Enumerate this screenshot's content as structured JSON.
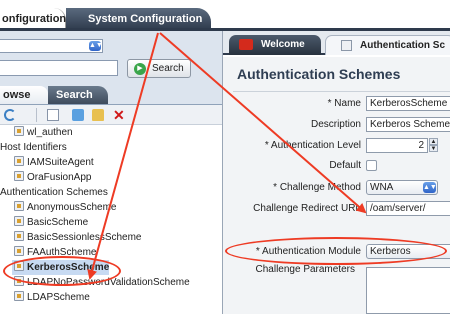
{
  "top_tabs": {
    "configuration": "onfiguration",
    "system_configuration": "System Configuration"
  },
  "left": {
    "search_button": "Search",
    "tabs": {
      "browse": "owse",
      "search": "Search"
    },
    "tree": [
      {
        "label": "wl_authen",
        "level": 1,
        "icon": "scheme-icon"
      },
      {
        "label": "Host Identifiers",
        "level": 0
      },
      {
        "label": "IAMSuiteAgent",
        "level": 1,
        "icon": "host-icon"
      },
      {
        "label": "OraFusionApp",
        "level": 1,
        "icon": "host-icon"
      },
      {
        "label": "Authentication Schemes",
        "level": 0
      },
      {
        "label": "AnonymousScheme",
        "level": 1,
        "icon": "scheme-icon"
      },
      {
        "label": "BasicScheme",
        "level": 1,
        "icon": "scheme-icon"
      },
      {
        "label": "BasicSessionlessScheme",
        "level": 1,
        "icon": "scheme-icon"
      },
      {
        "label": "FAAuthScheme",
        "level": 1,
        "icon": "scheme-icon"
      },
      {
        "label": "KerberosScheme",
        "level": 1,
        "icon": "scheme-icon",
        "selected": true
      },
      {
        "label": "LDAPNoPasswordValidationScheme",
        "level": 1,
        "icon": "scheme-icon"
      },
      {
        "label": "LDAPScheme",
        "level": 1,
        "icon": "scheme-icon"
      }
    ]
  },
  "right": {
    "tabs": {
      "welcome": "Welcome",
      "authentication": "Authentication Sc"
    },
    "title": "Authentication Schemes",
    "form": {
      "name": {
        "label": "* Name",
        "value": "KerberosScheme"
      },
      "description": {
        "label": "Description",
        "value": "Kerberos Scheme"
      },
      "auth_level": {
        "label": "* Authentication Level",
        "value": "2"
      },
      "default": {
        "label": "Default"
      },
      "challenge_method": {
        "label": "* Challenge Method",
        "value": "WNA"
      },
      "challenge_redirect": {
        "label": "Challenge Redirect URL",
        "value": "/oam/server/"
      },
      "auth_module": {
        "label": "* Authentication Module",
        "value": "Kerberos"
      },
      "challenge_params": {
        "label": "Challenge Parameters"
      }
    }
  },
  "colors": {
    "annotation": "#ee3b24",
    "navy": "#2e3a4c",
    "accent": "#2f64c8"
  }
}
